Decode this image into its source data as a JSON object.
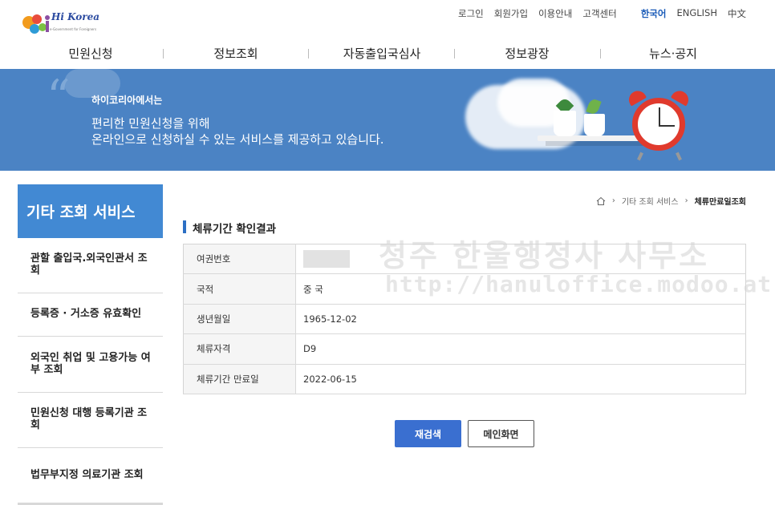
{
  "header": {
    "logo_text": "Hi Korea",
    "logo_sub": "e-Government for Foreigners",
    "util_links": [
      "로그인",
      "회원가입",
      "이용안내",
      "고객센터"
    ],
    "languages": [
      "한국어",
      "ENGLISH",
      "中文"
    ]
  },
  "gnb": [
    "민원신청",
    "정보조회",
    "자동출입국심사",
    "정보광장",
    "뉴스·공지"
  ],
  "banner": {
    "small": "하이코리아에서는",
    "line1": "편리한 민원신청을 위해",
    "line2": "온라인으로 신청하실 수 있는 서비스를 제공하고 있습니다."
  },
  "sidebar": {
    "title": "기타 조회 서비스",
    "items": [
      "관할 출입국.외국인관서 조회",
      "등록증 · 거소증 유효확인",
      "외국인 취업 및 고용가능 여부 조회",
      "민원신청 대행 등록기관 조회",
      "법무부지정 의료기관 조회"
    ]
  },
  "breadcrumb": {
    "level1": "기타 조회 서비스",
    "current": "체류만료일조회"
  },
  "section_title": "체류기간 확인결과",
  "watermark": {
    "line1": "청주 한울행정사 사무소",
    "line2": "http://hanuloffice.modoo.at"
  },
  "result_table": [
    {
      "label": "여권번호",
      "value": ""
    },
    {
      "label": "국적",
      "value": "중 국"
    },
    {
      "label": "생년월일",
      "value": "1965-12-02"
    },
    {
      "label": "체류자격",
      "value": "D9"
    },
    {
      "label": "체류기간 만료일",
      "value": "2022-06-15"
    }
  ],
  "buttons": {
    "research": "재검색",
    "main": "메인화면"
  },
  "colors": {
    "banner": "#4b83c4",
    "sidebar_title": "#4289d3",
    "primary_button": "#3a6fd0",
    "active_lang": "#1a5bb8"
  }
}
